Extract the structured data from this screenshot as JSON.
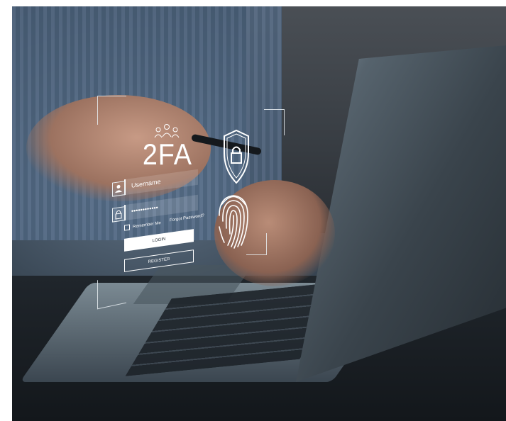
{
  "hud": {
    "title": "2FA",
    "username_label": "Username",
    "password_mask": "••••••••••••",
    "remember_label": "Remember Me",
    "forgot_label": "Forgot Password?",
    "login_label": "LOGIN",
    "register_label": "REGISTER"
  },
  "icons": {
    "users": "users-icon",
    "user": "user-icon",
    "lock": "lock-icon",
    "shield": "shield-lock-icon",
    "fingerprint": "fingerprint-icon"
  },
  "colors": {
    "overlay": "#ffffff",
    "background_dark": "#15191d",
    "shirt_blue": "#5f7693"
  }
}
